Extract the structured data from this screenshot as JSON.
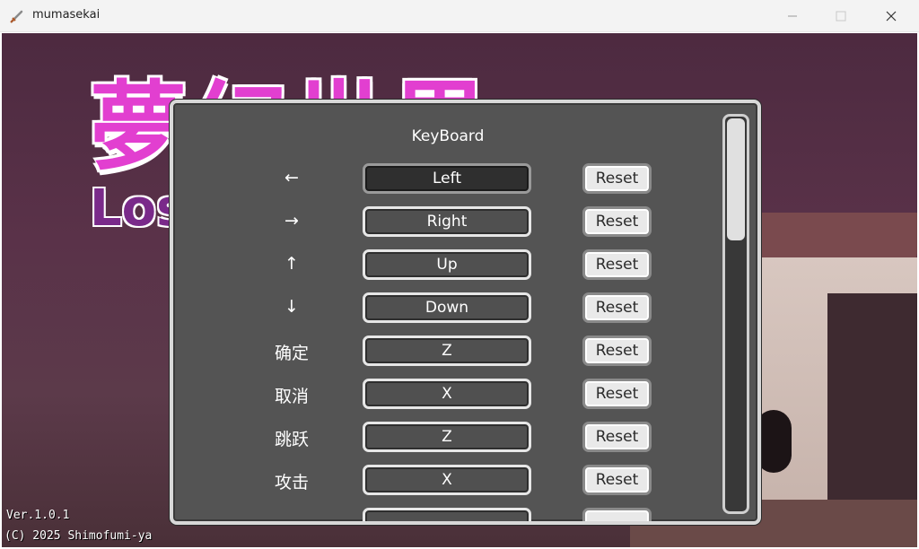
{
  "window": {
    "title": "mumasekai",
    "icon": "sword-icon",
    "controls": [
      "minimize-icon",
      "maximize-icon",
      "close-icon"
    ]
  },
  "game": {
    "logo_title": "夢幻世界",
    "logo_subtitle": "Lost",
    "version": "Ver.1.0.1",
    "copyright": "(C) 2025 Shimofumi-ya"
  },
  "keyboard_panel": {
    "title": "KeyBoard",
    "reset_label": "Reset",
    "bindings": [
      {
        "action": "←",
        "key": "Left",
        "selected": true
      },
      {
        "action": "→",
        "key": "Right",
        "selected": false
      },
      {
        "action": "↑",
        "key": "Up",
        "selected": false
      },
      {
        "action": "↓",
        "key": "Down",
        "selected": false
      },
      {
        "action": "确定",
        "key": "Z",
        "selected": false
      },
      {
        "action": "取消",
        "key": "X",
        "selected": false
      },
      {
        "action": "跳跃",
        "key": "Z",
        "selected": false
      },
      {
        "action": "攻击",
        "key": "X",
        "selected": false
      }
    ]
  },
  "colors": {
    "logo": "#e23fd0",
    "panel_bg": "#545454",
    "panel_border": "#d8d8d8"
  }
}
